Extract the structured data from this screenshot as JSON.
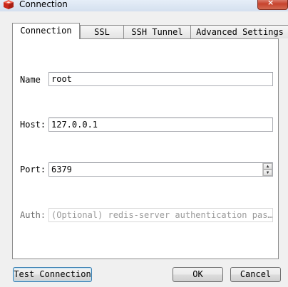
{
  "window": {
    "title": "Connection",
    "close_glyph": "×"
  },
  "tabs": [
    {
      "label": "Connection",
      "active": true
    },
    {
      "label": "SSL",
      "active": false
    },
    {
      "label": "SSH Tunnel",
      "active": false
    },
    {
      "label": "Advanced Settings",
      "active": false
    }
  ],
  "form": {
    "name": {
      "label": "Name",
      "value": "root"
    },
    "host": {
      "label": "Host:",
      "value": "127.0.0.1"
    },
    "port": {
      "label": "Port:",
      "value": "6379"
    },
    "auth": {
      "label": "Auth:",
      "placeholder": "(Optional) redis-server authentication pas…",
      "enabled": false
    }
  },
  "buttons": {
    "test": "Test Connection",
    "ok": "OK",
    "cancel": "Cancel"
  },
  "colors": {
    "app_icon": "#d9261c",
    "close_button": "#c7432d",
    "default_button_border": "#3c7fb1"
  },
  "icons": {
    "app": "redis-cube-icon",
    "close": "close-icon",
    "spin_up": "chevron-up-icon",
    "spin_down": "chevron-down-icon"
  }
}
